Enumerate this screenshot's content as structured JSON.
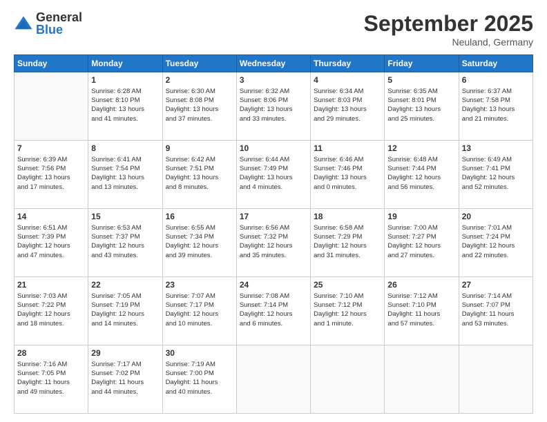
{
  "logo": {
    "general": "General",
    "blue": "Blue"
  },
  "header": {
    "month": "September 2025",
    "location": "Neuland, Germany"
  },
  "days": [
    "Sunday",
    "Monday",
    "Tuesday",
    "Wednesday",
    "Thursday",
    "Friday",
    "Saturday"
  ],
  "weeks": [
    [
      {
        "day": "",
        "content": ""
      },
      {
        "day": "1",
        "content": "Sunrise: 6:28 AM\nSunset: 8:10 PM\nDaylight: 13 hours\nand 41 minutes."
      },
      {
        "day": "2",
        "content": "Sunrise: 6:30 AM\nSunset: 8:08 PM\nDaylight: 13 hours\nand 37 minutes."
      },
      {
        "day": "3",
        "content": "Sunrise: 6:32 AM\nSunset: 8:06 PM\nDaylight: 13 hours\nand 33 minutes."
      },
      {
        "day": "4",
        "content": "Sunrise: 6:34 AM\nSunset: 8:03 PM\nDaylight: 13 hours\nand 29 minutes."
      },
      {
        "day": "5",
        "content": "Sunrise: 6:35 AM\nSunset: 8:01 PM\nDaylight: 13 hours\nand 25 minutes."
      },
      {
        "day": "6",
        "content": "Sunrise: 6:37 AM\nSunset: 7:58 PM\nDaylight: 13 hours\nand 21 minutes."
      }
    ],
    [
      {
        "day": "7",
        "content": "Sunrise: 6:39 AM\nSunset: 7:56 PM\nDaylight: 13 hours\nand 17 minutes."
      },
      {
        "day": "8",
        "content": "Sunrise: 6:41 AM\nSunset: 7:54 PM\nDaylight: 13 hours\nand 13 minutes."
      },
      {
        "day": "9",
        "content": "Sunrise: 6:42 AM\nSunset: 7:51 PM\nDaylight: 13 hours\nand 8 minutes."
      },
      {
        "day": "10",
        "content": "Sunrise: 6:44 AM\nSunset: 7:49 PM\nDaylight: 13 hours\nand 4 minutes."
      },
      {
        "day": "11",
        "content": "Sunrise: 6:46 AM\nSunset: 7:46 PM\nDaylight: 13 hours\nand 0 minutes."
      },
      {
        "day": "12",
        "content": "Sunrise: 6:48 AM\nSunset: 7:44 PM\nDaylight: 12 hours\nand 56 minutes."
      },
      {
        "day": "13",
        "content": "Sunrise: 6:49 AM\nSunset: 7:41 PM\nDaylight: 12 hours\nand 52 minutes."
      }
    ],
    [
      {
        "day": "14",
        "content": "Sunrise: 6:51 AM\nSunset: 7:39 PM\nDaylight: 12 hours\nand 47 minutes."
      },
      {
        "day": "15",
        "content": "Sunrise: 6:53 AM\nSunset: 7:37 PM\nDaylight: 12 hours\nand 43 minutes."
      },
      {
        "day": "16",
        "content": "Sunrise: 6:55 AM\nSunset: 7:34 PM\nDaylight: 12 hours\nand 39 minutes."
      },
      {
        "day": "17",
        "content": "Sunrise: 6:56 AM\nSunset: 7:32 PM\nDaylight: 12 hours\nand 35 minutes."
      },
      {
        "day": "18",
        "content": "Sunrise: 6:58 AM\nSunset: 7:29 PM\nDaylight: 12 hours\nand 31 minutes."
      },
      {
        "day": "19",
        "content": "Sunrise: 7:00 AM\nSunset: 7:27 PM\nDaylight: 12 hours\nand 27 minutes."
      },
      {
        "day": "20",
        "content": "Sunrise: 7:01 AM\nSunset: 7:24 PM\nDaylight: 12 hours\nand 22 minutes."
      }
    ],
    [
      {
        "day": "21",
        "content": "Sunrise: 7:03 AM\nSunset: 7:22 PM\nDaylight: 12 hours\nand 18 minutes."
      },
      {
        "day": "22",
        "content": "Sunrise: 7:05 AM\nSunset: 7:19 PM\nDaylight: 12 hours\nand 14 minutes."
      },
      {
        "day": "23",
        "content": "Sunrise: 7:07 AM\nSunset: 7:17 PM\nDaylight: 12 hours\nand 10 minutes."
      },
      {
        "day": "24",
        "content": "Sunrise: 7:08 AM\nSunset: 7:14 PM\nDaylight: 12 hours\nand 6 minutes."
      },
      {
        "day": "25",
        "content": "Sunrise: 7:10 AM\nSunset: 7:12 PM\nDaylight: 12 hours\nand 1 minute."
      },
      {
        "day": "26",
        "content": "Sunrise: 7:12 AM\nSunset: 7:10 PM\nDaylight: 11 hours\nand 57 minutes."
      },
      {
        "day": "27",
        "content": "Sunrise: 7:14 AM\nSunset: 7:07 PM\nDaylight: 11 hours\nand 53 minutes."
      }
    ],
    [
      {
        "day": "28",
        "content": "Sunrise: 7:16 AM\nSunset: 7:05 PM\nDaylight: 11 hours\nand 49 minutes."
      },
      {
        "day": "29",
        "content": "Sunrise: 7:17 AM\nSunset: 7:02 PM\nDaylight: 11 hours\nand 44 minutes."
      },
      {
        "day": "30",
        "content": "Sunrise: 7:19 AM\nSunset: 7:00 PM\nDaylight: 11 hours\nand 40 minutes."
      },
      {
        "day": "",
        "content": ""
      },
      {
        "day": "",
        "content": ""
      },
      {
        "day": "",
        "content": ""
      },
      {
        "day": "",
        "content": ""
      }
    ]
  ]
}
